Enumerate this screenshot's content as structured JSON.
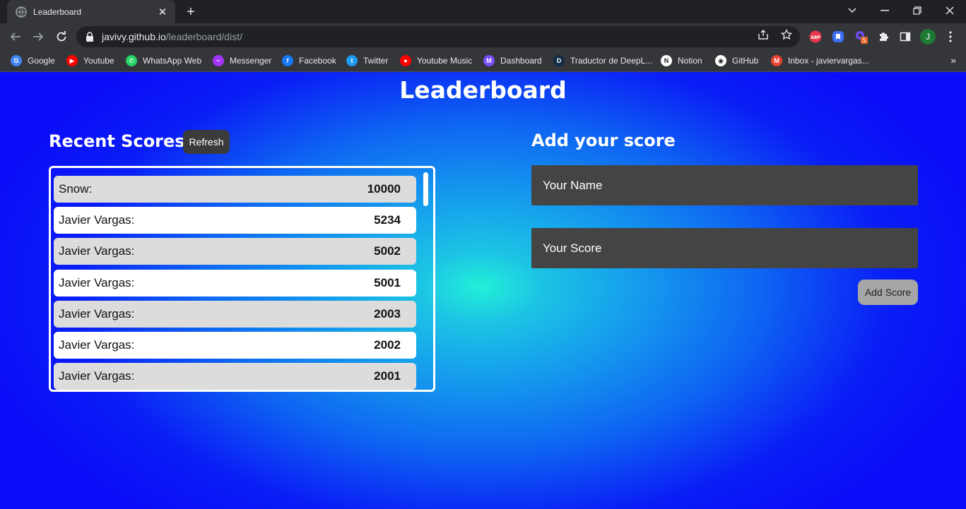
{
  "browser": {
    "tab": {
      "title": "Leaderboard",
      "close": "✕"
    },
    "new_tab": "+",
    "url": {
      "host": "javivy.github.io",
      "path": "/leaderboard/dist/"
    },
    "bookmarks": [
      {
        "label": "Google",
        "icon": "google-icon",
        "color": "#4285f4",
        "glyph": "G"
      },
      {
        "label": "Youtube",
        "icon": "youtube-icon",
        "color": "#ff0000",
        "glyph": "▶"
      },
      {
        "label": "WhatsApp Web",
        "icon": "whatsapp-icon",
        "color": "#25d366",
        "glyph": "✆"
      },
      {
        "label": "Messenger",
        "icon": "messenger-icon",
        "color": "#a334fa",
        "glyph": "~"
      },
      {
        "label": "Facebook",
        "icon": "facebook-icon",
        "color": "#1877f2",
        "glyph": "f"
      },
      {
        "label": "Twitter",
        "icon": "twitter-icon",
        "color": "#1d9bf0",
        "glyph": "t"
      },
      {
        "label": "Youtube Music",
        "icon": "youtube-music-icon",
        "color": "#ff0000",
        "glyph": "●"
      },
      {
        "label": "Dashboard",
        "icon": "dashboard-icon",
        "color": "#7b4dff",
        "glyph": "M"
      },
      {
        "label": "Traductor de DeepL...",
        "icon": "deepl-icon",
        "color": "#0f2b46",
        "glyph": "D"
      },
      {
        "label": "Notion",
        "icon": "notion-icon",
        "color": "#ffffff",
        "glyph": "N"
      },
      {
        "label": "GitHub",
        "icon": "github-icon",
        "color": "#ffffff",
        "glyph": "◉"
      },
      {
        "label": "Inbox - javiervargas...",
        "icon": "gmail-icon",
        "color": "#ea4335",
        "glyph": "M"
      }
    ],
    "more_bookmarks": "»",
    "profile_initial": "J",
    "extension_badge": "5"
  },
  "page": {
    "title": "Leaderboard",
    "recent": {
      "heading": "Recent Scores",
      "refresh_label": "Refresh",
      "rows": [
        {
          "name": "Snow:",
          "score": "10000"
        },
        {
          "name": "Javier Vargas:",
          "score": "5234"
        },
        {
          "name": "Javier Vargas:",
          "score": "5002"
        },
        {
          "name": "Javier Vargas:",
          "score": "5001"
        },
        {
          "name": "Javier Vargas:",
          "score": "2003"
        },
        {
          "name": "Javier Vargas:",
          "score": "2002"
        },
        {
          "name": "Javier Vargas:",
          "score": "2001"
        }
      ]
    },
    "add": {
      "heading": "Add your score",
      "name_placeholder": "Your Name",
      "score_placeholder": "Your Score",
      "submit_label": "Add Score"
    }
  }
}
